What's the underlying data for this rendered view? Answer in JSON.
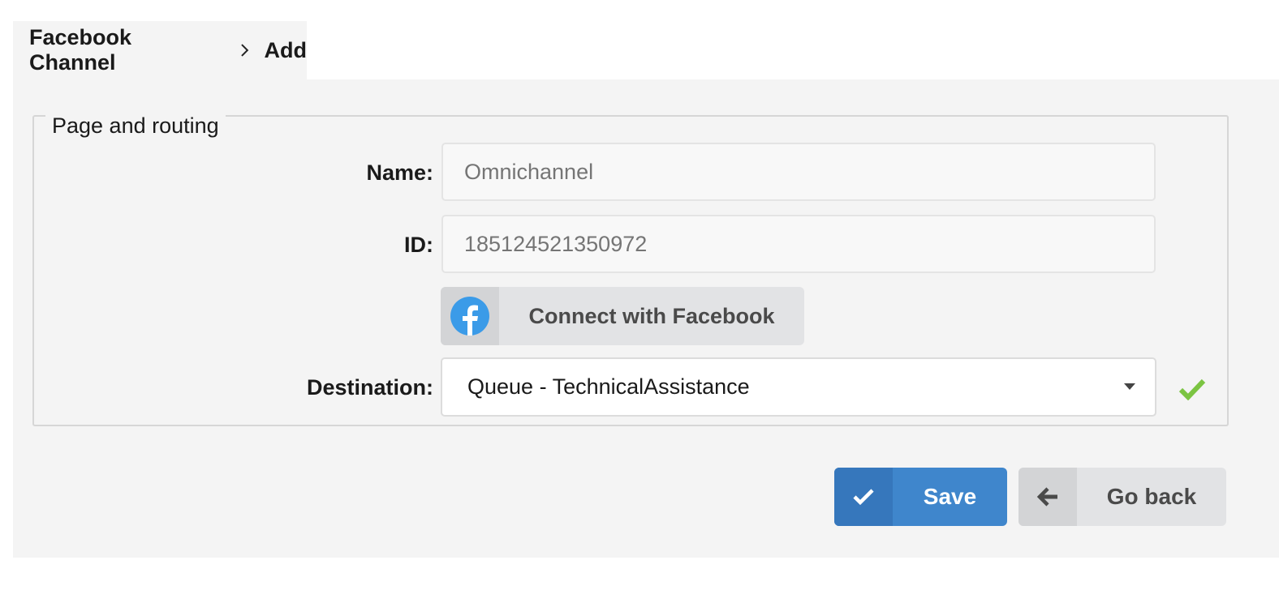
{
  "breadcrumb": {
    "parent": "Facebook Channel",
    "current": "Add"
  },
  "form": {
    "section_title": "Page and routing",
    "name_label": "Name:",
    "name_placeholder": "Omnichannel",
    "id_label": "ID:",
    "id_placeholder": "185124521350972",
    "connect_label": "Connect with Facebook",
    "destination_label": "Destination:",
    "destination_value": "Queue - TechnicalAssistance"
  },
  "actions": {
    "save_label": "Save",
    "back_label": "Go back"
  },
  "icons": {
    "separator": "chevron-right-icon",
    "facebook": "facebook-icon",
    "dropdown": "caret-down-icon",
    "valid": "check-icon",
    "save": "check-icon",
    "back": "arrow-left-icon"
  },
  "colors": {
    "primary": "#3f86cc",
    "facebook": "#3b9be8",
    "success": "#7bc442",
    "panel": "#f4f4f4"
  }
}
